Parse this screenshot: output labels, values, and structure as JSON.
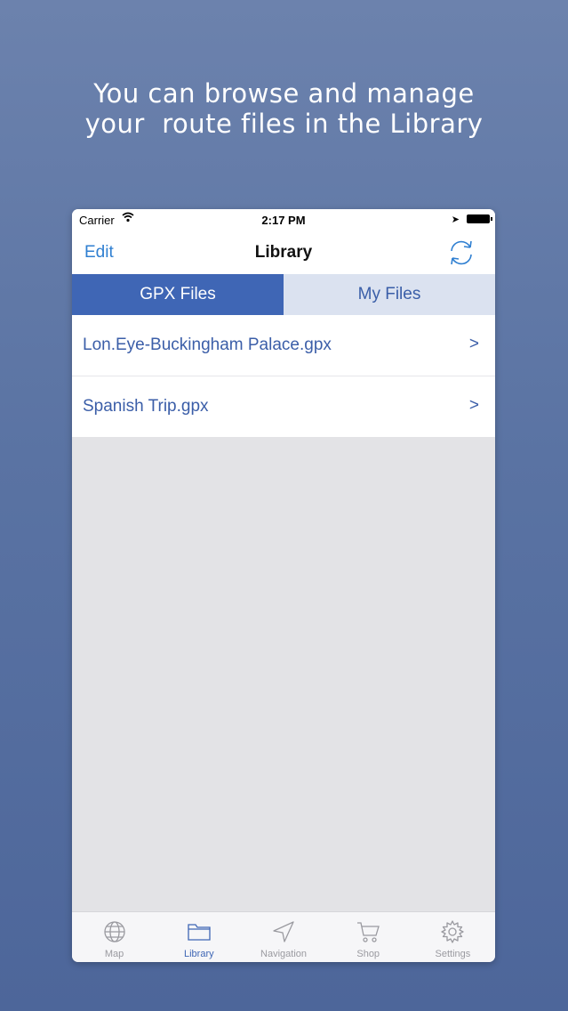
{
  "headline": {
    "line1": "You can browse and manage",
    "line2": "your  route files in the Library"
  },
  "status": {
    "carrier": "Carrier",
    "time": "2:17 PM"
  },
  "nav": {
    "edit_label": "Edit",
    "title": "Library"
  },
  "segments": {
    "gpx": "GPX Files",
    "my": "My Files",
    "selected": "GPX Files"
  },
  "files": [
    {
      "name": "Lon.Eye-Buckingham Palace.gpx",
      "chevron": ">"
    },
    {
      "name": "Spanish Trip.gpx",
      "chevron": ">"
    }
  ],
  "tabs": [
    {
      "label": "Map",
      "icon": "globe-icon"
    },
    {
      "label": "Library",
      "icon": "folder-icon",
      "active": true
    },
    {
      "label": "Navigation",
      "icon": "navigation-arrow-icon"
    },
    {
      "label": "Shop",
      "icon": "cart-icon"
    },
    {
      "label": "Settings",
      "icon": "gear-icon"
    }
  ],
  "colors": {
    "accent": "#3f66b5",
    "link": "#2f7fd1",
    "background_top": "#6c82ad",
    "background_bottom": "#4d669a"
  }
}
